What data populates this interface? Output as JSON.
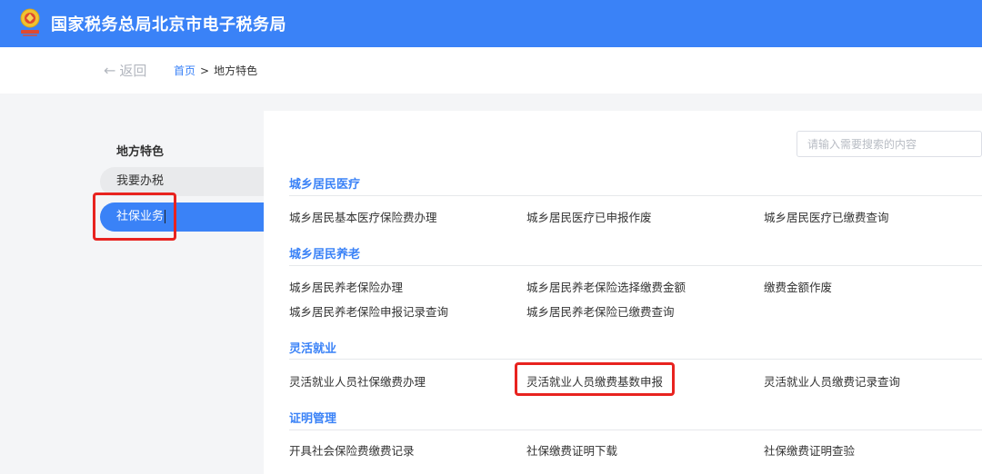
{
  "header": {
    "title": "国家税务总局北京市电子税务局",
    "logo_icon": "tax-emblem-icon",
    "bg_color": "#3a82f7"
  },
  "breadcrumb": {
    "back_label": "返回",
    "back_icon": "arrow-left-icon",
    "home": "首页",
    "separator": ">",
    "current": "地方特色"
  },
  "sidebar": {
    "title": "地方特色",
    "items": [
      {
        "label": "我要办税",
        "active": false
      },
      {
        "label": "社保业务",
        "active": true
      }
    ]
  },
  "search": {
    "placeholder": "请输入需要搜索的内容",
    "value": ""
  },
  "sections": [
    {
      "title": "城乡居民医疗",
      "items": [
        "城乡居民基本医疗保险费办理",
        "城乡居民医疗已申报作废",
        "城乡居民医疗已缴费查询"
      ]
    },
    {
      "title": "城乡居民养老",
      "items": [
        "城乡居民养老保险办理",
        "城乡居民养老保险选择缴费金额",
        "缴费金额作废",
        "城乡居民养老保险申报记录查询",
        "城乡居民养老保险已缴费查询"
      ]
    },
    {
      "title": "灵活就业",
      "items": [
        "灵活就业人员社保缴费办理",
        "灵活就业人员缴费基数申报",
        "灵活就业人员缴费记录查询"
      ]
    },
    {
      "title": "证明管理",
      "items": [
        "开具社会保险费缴费记录",
        "社保缴费证明下载",
        "社保缴费证明查验"
      ]
    }
  ],
  "highlight_color": "#e8231f"
}
